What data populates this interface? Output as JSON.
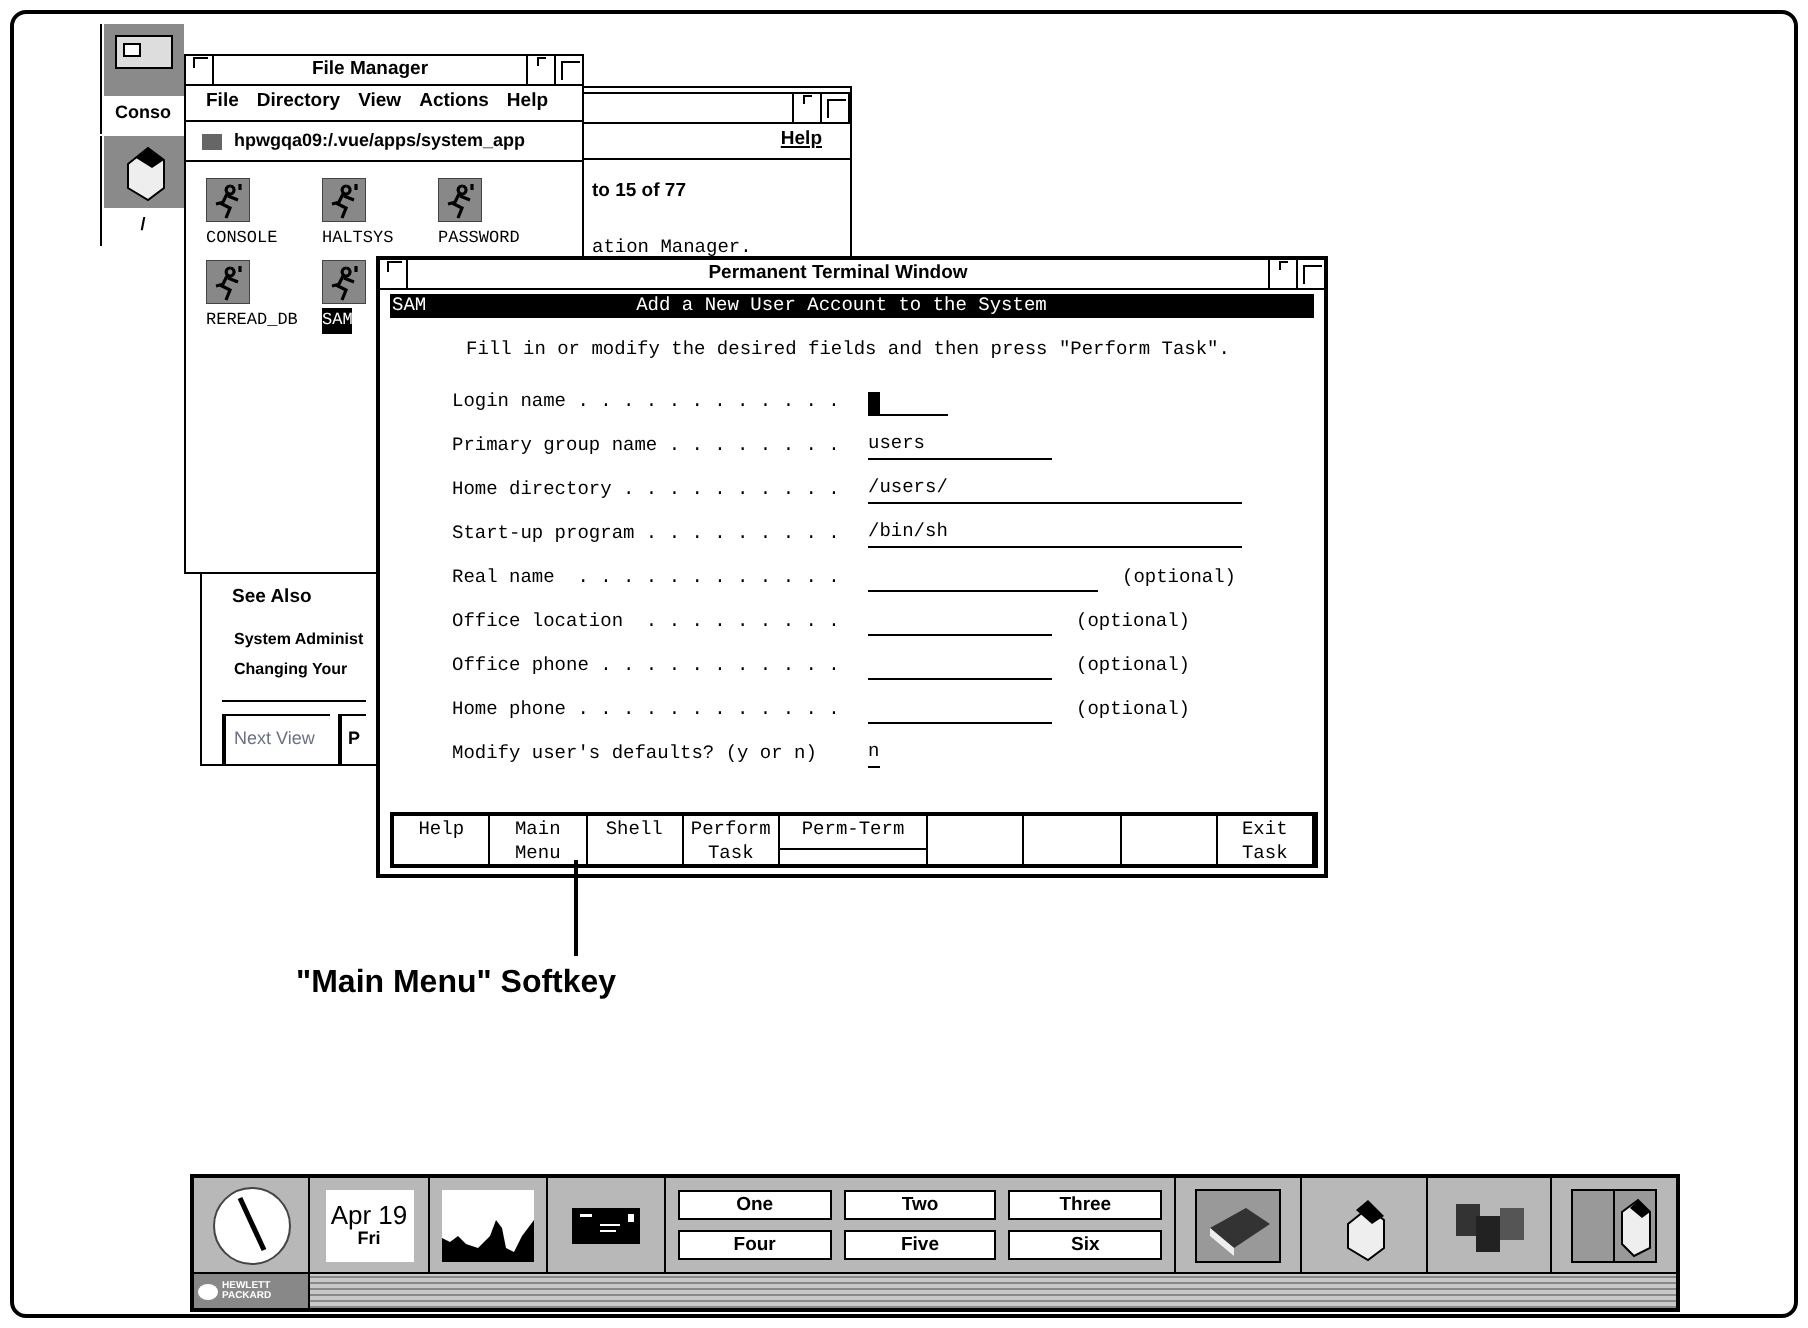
{
  "desktop_icons": [
    {
      "label": "Conso"
    },
    {
      "label": "/"
    }
  ],
  "help_window": {
    "menu": [
      "Help"
    ],
    "position": "to 15 of 77",
    "text": "ation Manager.",
    "see_also": {
      "heading": "See Also",
      "links": [
        "System Administ",
        "Changing Your"
      ]
    },
    "buttons": [
      "Next View",
      "P"
    ]
  },
  "file_manager": {
    "title": "File Manager",
    "menu": [
      "File",
      "Directory",
      "View",
      "Actions",
      "Help"
    ],
    "path": "hpwgqa09:/.vue/apps/system_app",
    "files": [
      {
        "name": "CONSOLE",
        "selected": false
      },
      {
        "name": "HALTSYS",
        "selected": false
      },
      {
        "name": "PASSWORD",
        "selected": false
      },
      {
        "name": "REREAD_DB",
        "selected": false
      },
      {
        "name": "SAM",
        "selected": true
      }
    ]
  },
  "terminal": {
    "title": "Permanent Terminal Window",
    "app": "SAM",
    "heading": "Add a New User Account to the System",
    "instruction": "Fill in or modify the desired fields and then press \"Perform Task\".",
    "fields": [
      {
        "label": "Login name . . . . . . . . . . . .",
        "cursor": true
      },
      {
        "label": "Primary group name . . . . . . . .",
        "value": "users"
      },
      {
        "label": "Home directory . . . . . . . . . .",
        "value": "/users/"
      },
      {
        "label": "Start-up program . . . . . . . . .",
        "value": "/bin/sh"
      },
      {
        "label": "Real name  . . . . . . . . . . . .",
        "note": "(optional)"
      },
      {
        "label": "Office location  . . . . . . . . .",
        "note": "(optional)"
      },
      {
        "label": "Office phone . . . . . . . . . . .",
        "note": "(optional)"
      },
      {
        "label": "Home phone . . . . . . . . . . . .",
        "note": "(optional)"
      },
      {
        "label": "Modify user's defaults? (y or n)",
        "value": "n"
      }
    ],
    "softkeys": [
      {
        "lines": [
          "Help"
        ]
      },
      {
        "lines": [
          "Main",
          "Menu"
        ]
      },
      {
        "lines": [
          "Shell"
        ]
      },
      {
        "lines": [
          "Perform",
          "Task"
        ]
      },
      {
        "lines": [
          "Perm-Term"
        ]
      },
      {
        "lines": [
          "Exit",
          "Task"
        ]
      }
    ]
  },
  "caption": "\"Main Menu\" Softkey",
  "front_panel": {
    "date": {
      "month_day": "Apr 19",
      "weekday": "Fri"
    },
    "workspaces": [
      "One",
      "Two",
      "Three",
      "Four",
      "Five",
      "Six"
    ],
    "logo": "HEWLETT PACKARD"
  }
}
